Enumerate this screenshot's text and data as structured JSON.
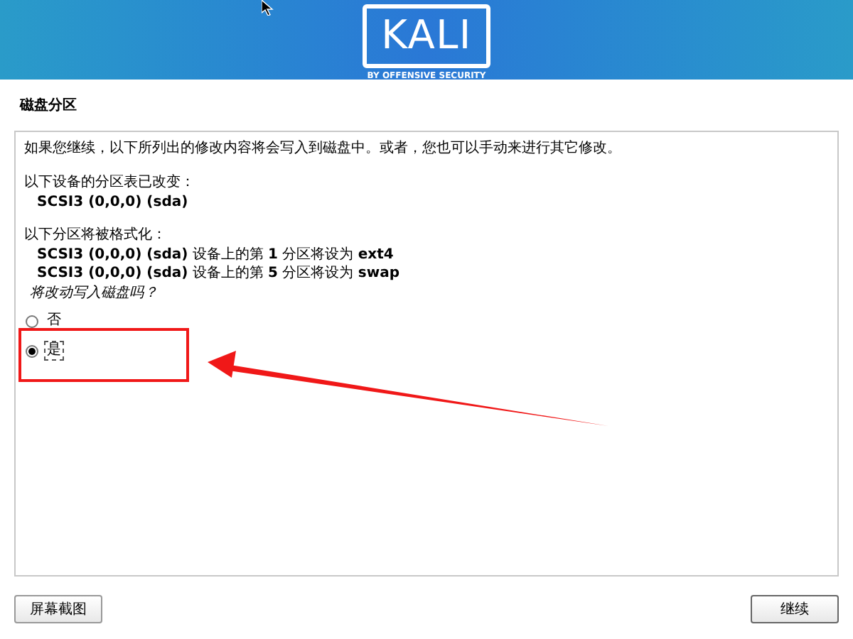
{
  "banner": {
    "logo": "KALI",
    "tagline": "BY OFFENSIVE SECURITY"
  },
  "title": "磁盘分区",
  "panel": {
    "intro": "如果您继续，以下所列出的修改内容将会写入到磁盘中。或者，您也可以手动来进行其它修改。",
    "sections": [
      {
        "heading": "以下设备的分区表已改变：",
        "items": [
          "**SCSI3 (0,0,0) (sda)**"
        ]
      },
      {
        "heading": "以下分区将被格式化：",
        "items": [
          "**SCSI3 (0,0,0) (sda)** 设备上的第 **1** 分区将设为 **ext4**",
          "**SCSI3 (0,0,0) (sda)** 设备上的第 **5** 分区将设为 **swap**"
        ]
      }
    ],
    "question": "将改动写入磁盘吗？",
    "options": [
      {
        "label": "否",
        "selected": false
      },
      {
        "label": "是",
        "selected": true
      }
    ]
  },
  "buttons": {
    "left": "屏幕截图",
    "right": "继续"
  }
}
